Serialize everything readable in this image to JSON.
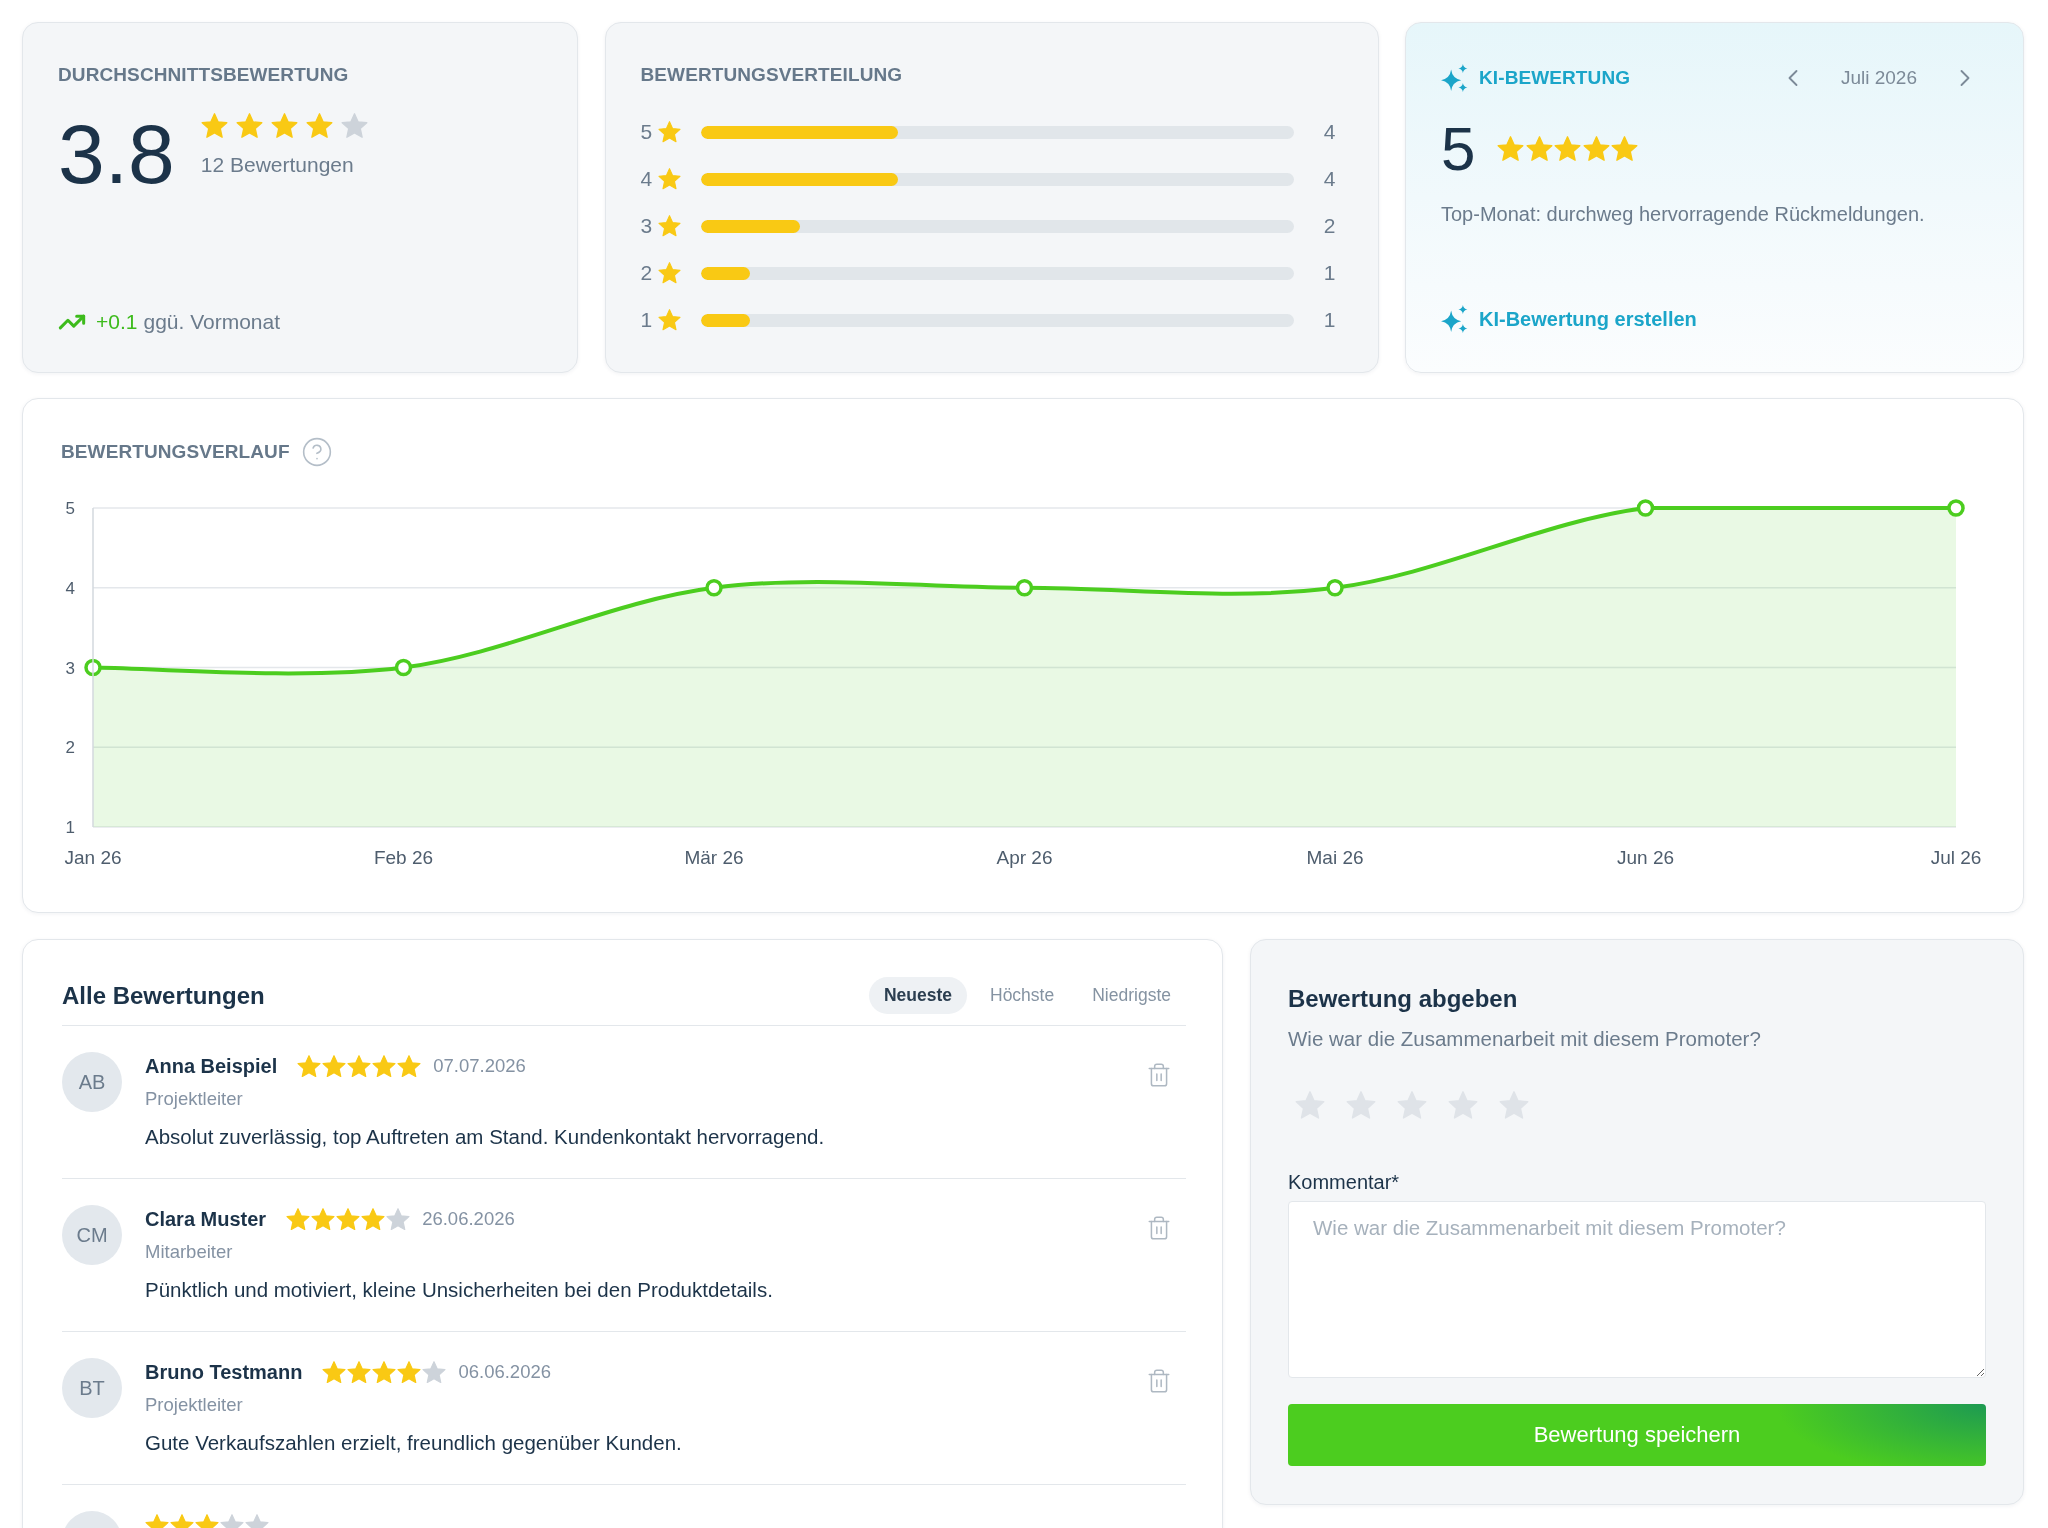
{
  "average_rating": {
    "title": "DURCHSCHNITTSBEWERTUNG",
    "value": "3.8",
    "stars": 4,
    "count": "12 Bewertungen",
    "trend": {
      "kind": "up",
      "change": "+0.1",
      "label": "ggü. Vormonat"
    }
  },
  "distribution": {
    "title": "BEWERTUNGSVERTEILUNG",
    "rows": [
      {
        "label": "5",
        "level": 0.333,
        "count": "4"
      },
      {
        "label": "4",
        "level": 0.333,
        "count": "4"
      },
      {
        "label": "3",
        "level": 0.167,
        "count": "2"
      },
      {
        "label": "2",
        "level": 0.083,
        "count": "1"
      },
      {
        "label": "1",
        "level": 0.083,
        "count": "1"
      }
    ]
  },
  "ai_rating": {
    "title": "KI-BEWERTUNG",
    "period": "Juli 2026",
    "value": "5",
    "stars": 5,
    "summary": "Top-Monat: durchweg hervorragende Rückmeldungen.",
    "action": "KI-Bewertung erstellen"
  },
  "history": {
    "title": "BEWERTUNGSVERLAUF",
    "chart_data": {
      "type": "area",
      "categories": [
        "Jan 26",
        "Feb 26",
        "Mär 26",
        "Apr 26",
        "Mai 26",
        "Jun 26",
        "Jul 26"
      ],
      "series": [
        {
          "color": "#4ccd1f",
          "values": [
            3,
            3,
            4,
            4,
            4,
            5,
            5
          ]
        }
      ],
      "ylim": [
        1,
        5
      ],
      "yticks": [
        1,
        2,
        3,
        4,
        5
      ],
      "grid": true
    }
  },
  "reviews": {
    "title": "Alle Bewertungen",
    "sort_tabs": [
      {
        "label": "Neueste",
        "selected": true
      },
      {
        "label": "Höchste",
        "selected": false
      },
      {
        "label": "Niedrigste",
        "selected": false
      }
    ],
    "items": [
      {
        "initials": "AB",
        "name": "Anna Beispiel",
        "stars": 5,
        "date": "07.07.2026",
        "role": "Projektleiter",
        "comment": "Absolut zuverlässig, top Auftreten am Stand. Kundenkontakt hervorragend."
      },
      {
        "initials": "CM",
        "name": "Clara Muster",
        "stars": 4,
        "date": "26.06.2026",
        "role": "Mitarbeiter",
        "comment": "Pünktlich und motiviert, kleine Unsicherheiten bei den Produktdetails."
      },
      {
        "initials": "BT",
        "name": "Bruno Testmann",
        "stars": 4,
        "date": "06.06.2026",
        "role": "Projektleiter",
        "comment": "Gute Verkaufszahlen erzielt, freundlich gegenüber Kunden."
      },
      {
        "stars": 3
      }
    ]
  },
  "rating_form": {
    "title": "Bewertung abgeben",
    "question": "Wie war die Zusammenarbeit mit diesem Promoter?",
    "stars": 0,
    "comment": {
      "label": "Kommentar*",
      "placeholder": "Wie war die Zusammenarbeit mit diesem Promoter?"
    },
    "submit": "Bewertung speichern"
  }
}
